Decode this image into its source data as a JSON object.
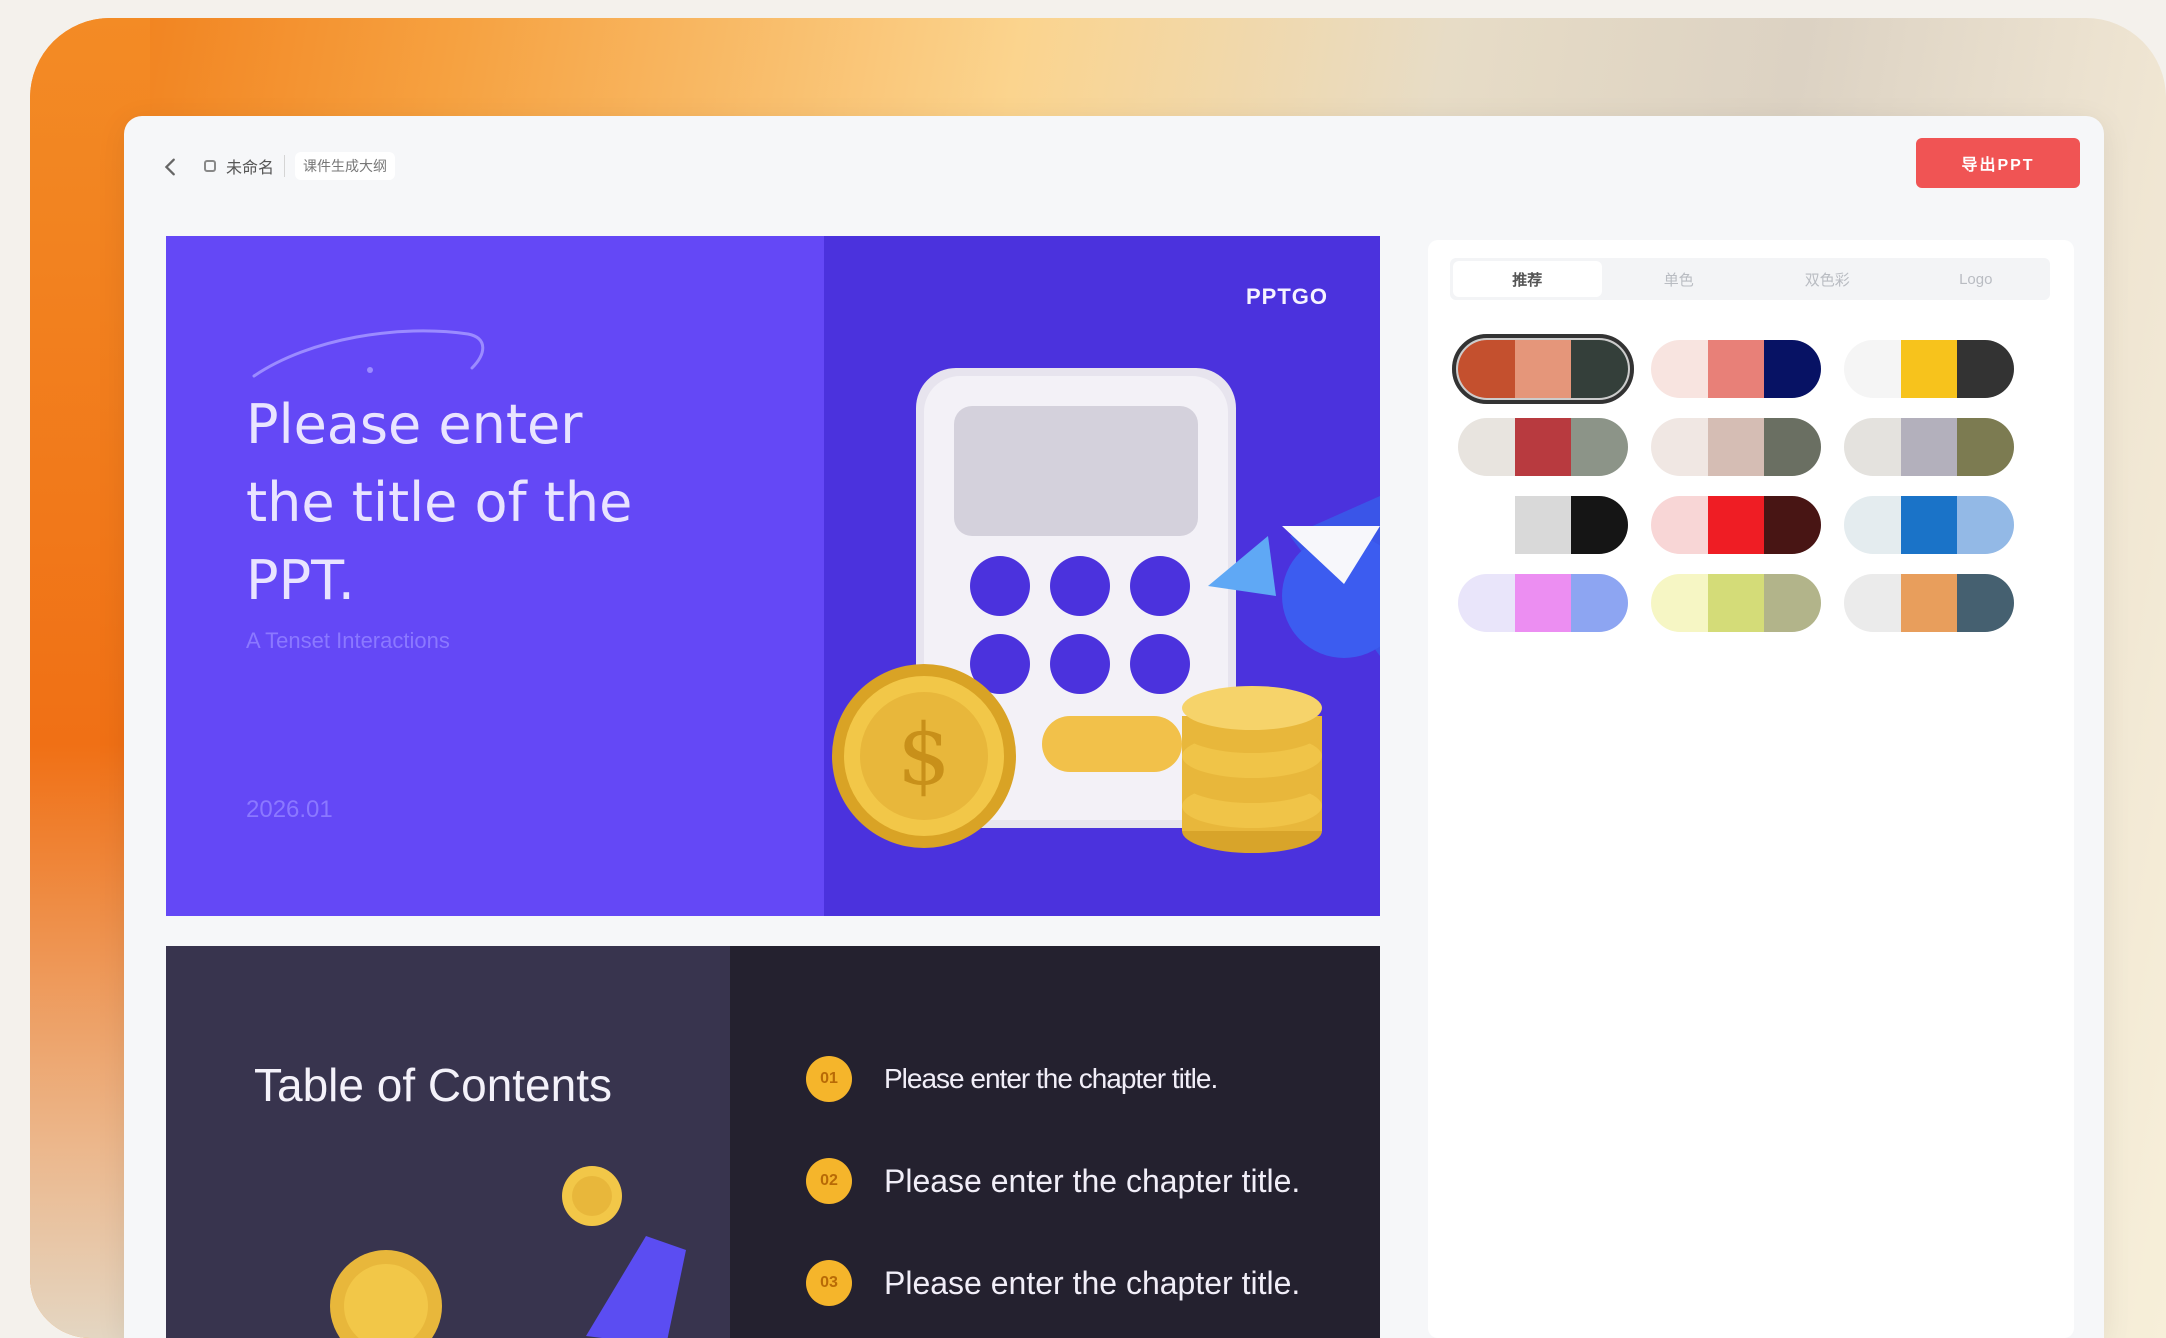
{
  "topbar": {
    "doc_name": "未命名",
    "tag": "课件生成大纲",
    "cta_label": "导出PPT"
  },
  "slide1": {
    "title": "Please enter the title of the PPT.",
    "subtitle": "A Tenset Interactions",
    "date": "2026.01",
    "brand": "PPTGO"
  },
  "slide2": {
    "title": "Table of Contents",
    "chapters": [
      {
        "num": "01",
        "text": "Please enter the chapter title."
      },
      {
        "num": "02",
        "text": "Please enter the chapter title."
      },
      {
        "num": "03",
        "text": "Please enter the chapter title."
      }
    ]
  },
  "panel": {
    "tabs": [
      "推荐",
      "单色",
      "双色彩",
      "Logo"
    ],
    "active_tab": 0,
    "palettes": [
      [
        "#c4502e",
        "#e5967a",
        "#343f3a"
      ],
      [
        "#f8e4e0",
        "#e88078",
        "#071264"
      ],
      [
        "#f5f5f5",
        "#f7c31c",
        "#333333"
      ],
      [
        "#e8e4df",
        "#b83a3f",
        "#8c9488"
      ],
      [
        "#f0e7e3",
        "#d5bdb4",
        "#6a6f62"
      ],
      [
        "#e4e2de",
        "#b3b0bc",
        "#7c7b51"
      ],
      [
        "#ffffff",
        "#d9d9d9",
        "#151515"
      ],
      [
        "#f8d6d6",
        "#ef1d24",
        "#481514"
      ],
      [
        "#e4ecef",
        "#1a73c8",
        "#93b9e6"
      ],
      [
        "#e9e5fa",
        "#ec8ef2",
        "#8da5f2"
      ],
      [
        "#f6f6c4",
        "#d4dc78",
        "#b2b48a"
      ],
      [
        "#ebebeb",
        "#e89e5c",
        "#456070"
      ]
    ],
    "selected_palette": 0
  }
}
